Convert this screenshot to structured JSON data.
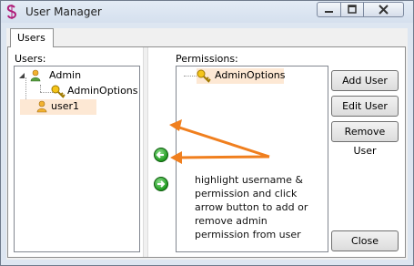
{
  "window": {
    "title": "User Manager"
  },
  "tabs": [
    {
      "label": "Users"
    }
  ],
  "users_panel": {
    "label": "Users:",
    "tree": {
      "root": "Admin",
      "child": "AdminOptions",
      "selected": "user1"
    }
  },
  "permissions_panel": {
    "label": "Permissions:",
    "items": [
      "AdminOptions"
    ]
  },
  "buttons": {
    "add_user": "Add User",
    "edit_user": "Edit User",
    "remove_user": "Remove User",
    "close": "Close"
  },
  "annotation": "highlight username & permission and click arrow button to add or remove admin permission from user",
  "colors": {
    "highlight": "#fde8d4",
    "annotation_arrow": "#f07f1e",
    "arrow_button": "#1e9a1e"
  }
}
